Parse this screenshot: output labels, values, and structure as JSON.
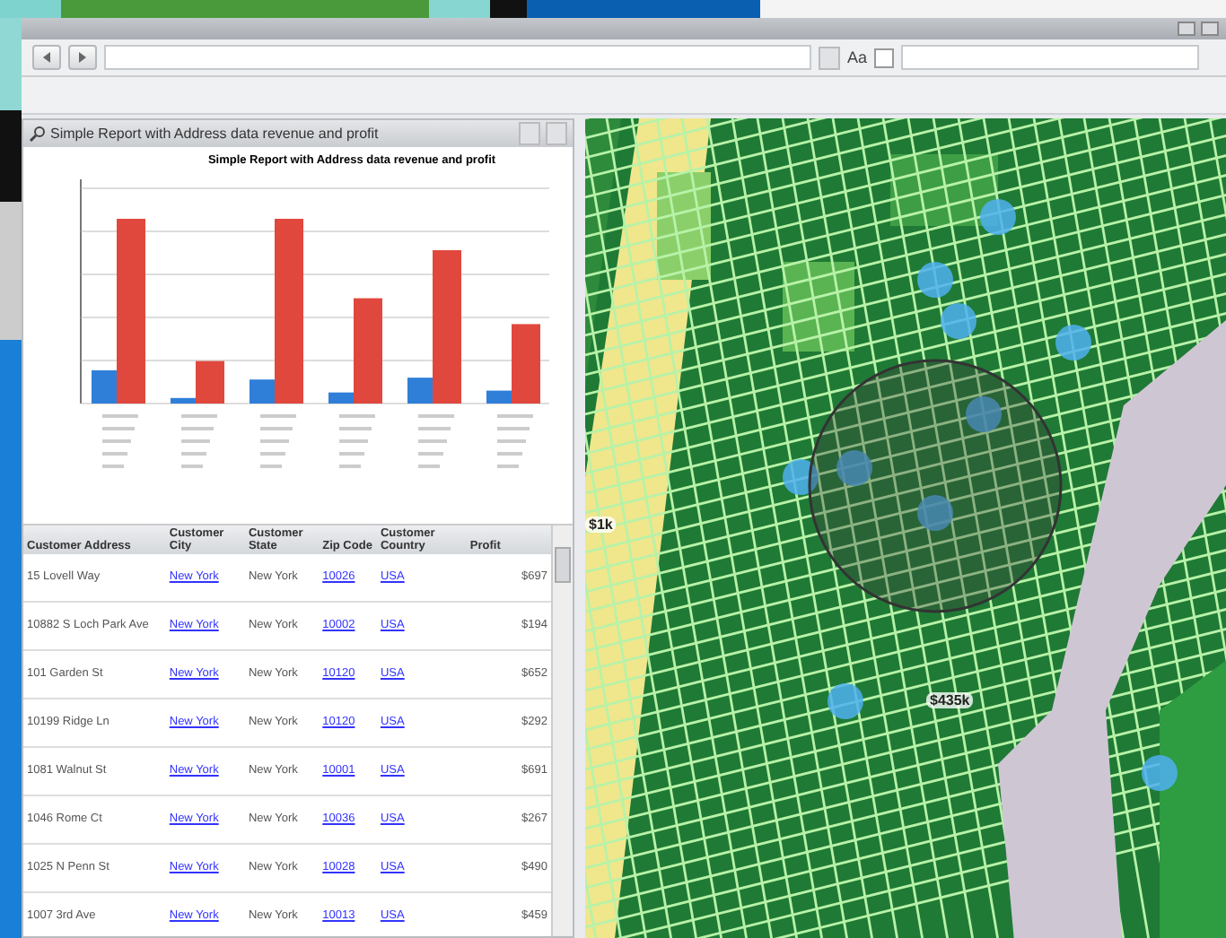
{
  "toolbar": {
    "find_label": "Aa",
    "match_case_checked": false
  },
  "report_panel": {
    "title": "Simple Report with Address data revenue and profit",
    "chart_title": "Simple Report with Address data revenue and profit"
  },
  "table": {
    "columns": [
      "Customer Address",
      "Customer City",
      "Customer State",
      "Zip Code",
      "Customer Country",
      "Profit"
    ],
    "rows": [
      {
        "address": "15 Lovell Way",
        "city": "New York",
        "state": "New York",
        "zip": "10026",
        "country": "USA",
        "profit": "$697"
      },
      {
        "address": "10882 S Loch Park Ave",
        "city": "New York",
        "state": "New York",
        "zip": "10002",
        "country": "USA",
        "profit": "$194"
      },
      {
        "address": "101 Garden St",
        "city": "New York",
        "state": "New York",
        "zip": "10120",
        "country": "USA",
        "profit": "$652"
      },
      {
        "address": "10199 Ridge Ln",
        "city": "New York",
        "state": "New York",
        "zip": "10120",
        "country": "USA",
        "profit": "$292"
      },
      {
        "address": "1081 Walnut St",
        "city": "New York",
        "state": "New York",
        "zip": "10001",
        "country": "USA",
        "profit": "$691"
      },
      {
        "address": "1046 Rome Ct",
        "city": "New York",
        "state": "New York",
        "zip": "10036",
        "country": "USA",
        "profit": "$267"
      },
      {
        "address": "1025 N Penn St",
        "city": "New York",
        "state": "New York",
        "zip": "10028",
        "country": "USA",
        "profit": "$490"
      },
      {
        "address": "1007 3rd Ave",
        "city": "New York",
        "state": "New York",
        "zip": "10013",
        "country": "USA",
        "profit": "$459"
      }
    ]
  },
  "map": {
    "labels": [
      "$1k",
      "$435k"
    ]
  }
}
